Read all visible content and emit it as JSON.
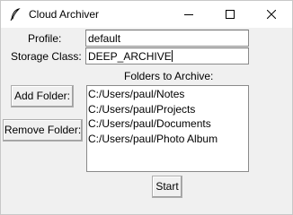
{
  "window": {
    "title": "Cloud Archiver",
    "icon": "feather-icon",
    "controls": [
      "minimize-icon",
      "maximize-icon",
      "close-icon"
    ]
  },
  "form": {
    "profile_label": "Profile:",
    "profile_value": "default",
    "storage_class_label": "Storage Class:",
    "storage_class_value": "DEEP_ARCHIVE",
    "folders_label": "Folders to Archive:"
  },
  "buttons": {
    "add_folder": "Add Folder:",
    "remove_folder": "Remove Folder:",
    "start": "Start"
  },
  "folders": [
    "C:/Users/paul/Notes",
    "C:/Users/paul/Projects",
    "C:/Users/paul/Documents",
    "C:/Users/paul/Photo Album"
  ],
  "colors": {
    "background": "#f0f0f0",
    "titlebar": "#ffffff",
    "field": "#ffffff",
    "border": "#8a8a8a"
  }
}
